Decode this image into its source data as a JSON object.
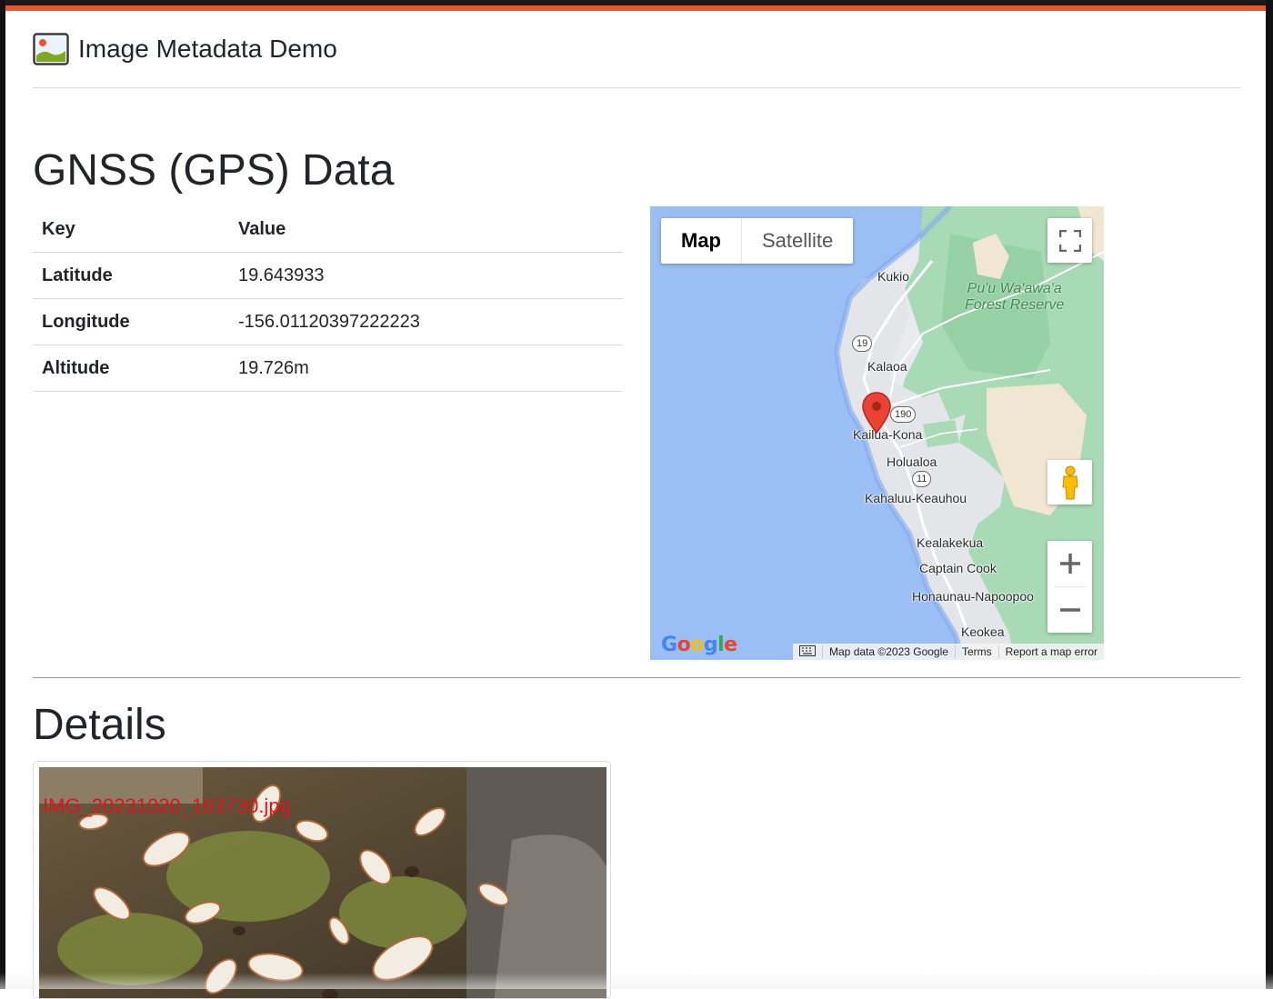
{
  "header": {
    "title": "Image Metadata Demo"
  },
  "gnss": {
    "title": "GNSS (GPS) Data",
    "table": {
      "headers": [
        "Key",
        "Value"
      ],
      "rows": [
        {
          "key": "Latitude",
          "value": "19.643933"
        },
        {
          "key": "Longitude",
          "value": "-156.01120397222223"
        },
        {
          "key": "Altitude",
          "value": "19.726m"
        }
      ]
    }
  },
  "map": {
    "type_buttons": {
      "map": "Map",
      "satellite": "Satellite"
    },
    "forest_label_line1": "Pu'u Wa'awa'a",
    "forest_label_line2": "Forest Reserve",
    "places": {
      "kukio": "Kukio",
      "kalaoa": "Kalaoa",
      "kailua_kona": "Kailua-Kona",
      "holualoa": "Holualoa",
      "kahaluu": "Kahaluu-Keauhou",
      "kealakekua": "Kealakekua",
      "captain_cook": "Captain Cook",
      "honaunau": "Honaunau-Napoopoo",
      "keokea": "Keokea"
    },
    "routes": {
      "r19": "19",
      "r190": "190",
      "r11": "11"
    },
    "footer": {
      "map_data": "Map data ©2023 Google",
      "terms": "Terms",
      "report": "Report a map error"
    },
    "colors": {
      "water": "#9bbff4",
      "land": "#e8eaed",
      "forest": "#a8dab5",
      "marker": "#ea4335"
    }
  },
  "details": {
    "title": "Details",
    "photo_caption": "IMG_20231020_163730.jpg"
  },
  "colors": {
    "accent_bar": "#e8562a"
  }
}
